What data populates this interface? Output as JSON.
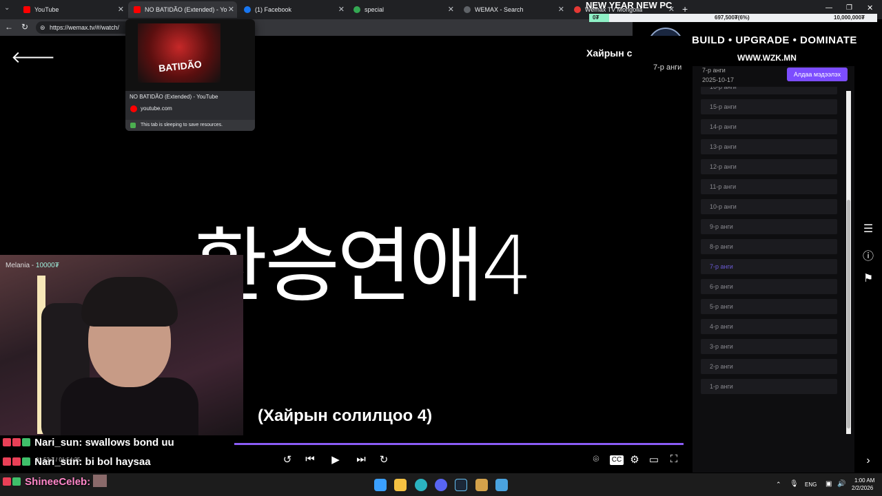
{
  "browser": {
    "tabs": [
      {
        "label": "YouTube",
        "color": "#ff0000"
      },
      {
        "label": "NO BATIDÃO (Extended) - YouTube",
        "color": "#ff0000"
      },
      {
        "label": "(1) Facebook",
        "color": "#1877f2"
      },
      {
        "label": "special",
        "color": "#34a853"
      },
      {
        "label": "WEMAX - Search",
        "color": "#5f6368"
      },
      {
        "label": "Wemax TV Mongolia",
        "color": "#e53935"
      }
    ],
    "url": "https://wemax.tv/#/watch/",
    "preview": {
      "title": "NO BATIDÃO (Extended) - YouTube",
      "domain": "youtube.com",
      "status": "This tab is sleeping to save resources.",
      "thumb_text": "BATIDÃO"
    }
  },
  "overlay": {
    "new_year": "NEW YEAR NEW PC",
    "progress_left": "0₮",
    "progress_mid": "697,500₮(6%)",
    "progress_right": "10,000,000₮",
    "progress_fraction": 0.07,
    "logo_text": "WZK",
    "slogan": "BUILD • UPGRADE • DOMINATE",
    "url": "WWW.WZK.MN"
  },
  "player": {
    "title": "Хайрын с",
    "episode": "7-р анги",
    "show_logo": "환승연애4",
    "subtitle": "(Хайрын солилцоо 4)",
    "time": "01:53:7 / 01:54:25"
  },
  "sidebar": {
    "episode": "7-р анги",
    "date": "2025-10-17",
    "report_button": "Алдаа мэдээлэх",
    "episodes": [
      "16-р анги",
      "15-р анги",
      "14-р анги",
      "13-р анги",
      "12-р анги",
      "11-р анги",
      "10-р анги",
      "9-р анги",
      "8-р анги",
      "7-р анги",
      "6-р анги",
      "5-р анги",
      "4-р анги",
      "3-р анги",
      "2-р анги",
      "1-р анги"
    ],
    "active_episode": "7-р анги"
  },
  "webcam": {
    "label_name": "Melania -",
    "label_amount": "10000₮"
  },
  "chat": [
    {
      "user": "Nari_sun:",
      "message": "swallows bond uu"
    },
    {
      "user": "Nari_sun:",
      "message": "bi bol haysaa"
    },
    {
      "user": "ShineeCeleb:",
      "message": ""
    }
  ],
  "taskbar": {
    "lang": "ENG",
    "time": "1:00 AM",
    "date": "2/2/2026"
  }
}
